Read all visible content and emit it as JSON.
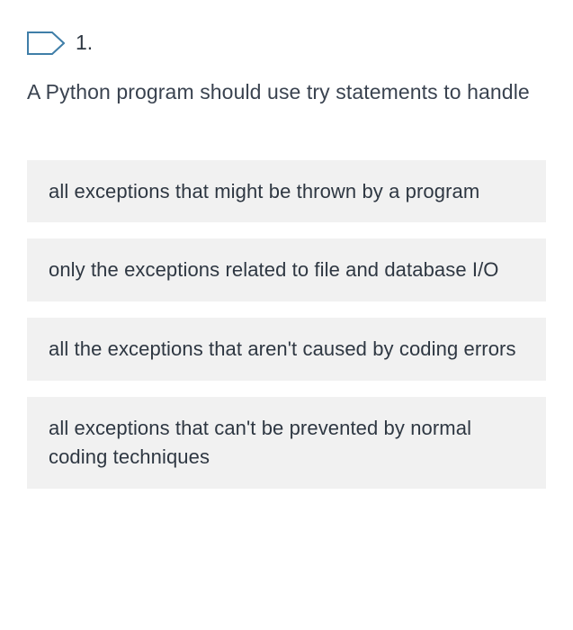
{
  "question": {
    "number": "1.",
    "text": "A Python program should use try statements to handle"
  },
  "choices": [
    {
      "text": "all exceptions that might be thrown by a program"
    },
    {
      "text": "only the exceptions related to file and database I/O"
    },
    {
      "text": "all the exceptions that aren't caused by coding errors"
    },
    {
      "text": "all exceptions that can't be prevented by normal coding techniques"
    }
  ],
  "colors": {
    "icon_stroke": "#3f7ea8",
    "choice_bg": "#f1f1f1",
    "text": "#3a4350"
  }
}
